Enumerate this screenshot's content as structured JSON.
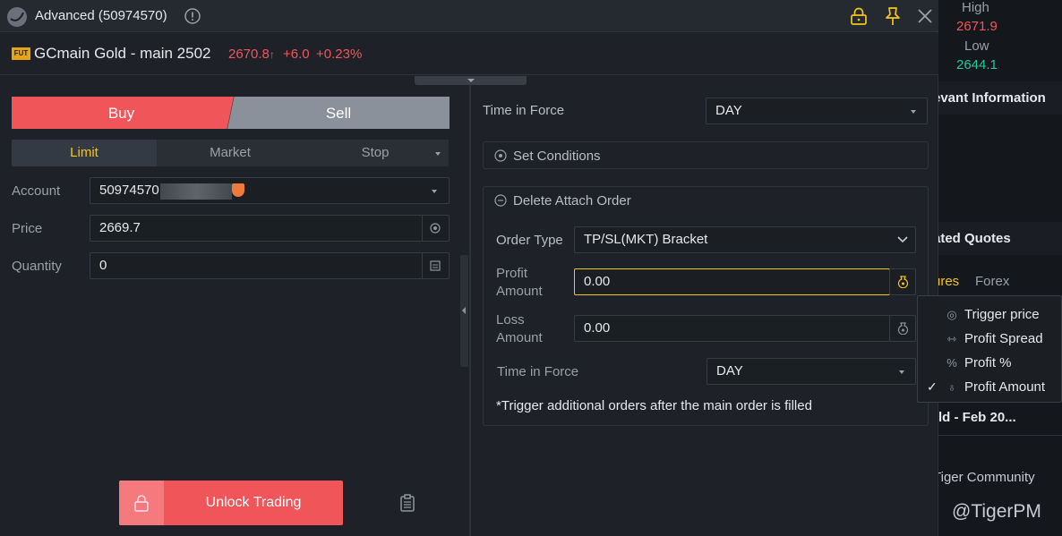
{
  "window": {
    "title": "Advanced (50974570)",
    "info_icon": "info-circle-icon",
    "lock_icon": "lock-icon",
    "pin_icon": "pin-icon",
    "close_icon": "close-icon"
  },
  "symbol": {
    "badge": "FUT",
    "name": "GCmain Gold - main 2502",
    "last": "2670.8",
    "arrow": "↑",
    "change": "+6.0",
    "change_pct": "+0.23%"
  },
  "background": {
    "high_label": "High",
    "high_value": "2671.9",
    "low_label": "Low",
    "low_value": "2644.1",
    "relevant_info": "evant Information",
    "related_quotes": "ated Quotes",
    "tab_futures": "ures",
    "tab_forex": "Forex",
    "list_item": "ld - Feb 20...",
    "community_label": "Tiger Community",
    "handle": "@TigerPM"
  },
  "order": {
    "buy_label": "Buy",
    "sell_label": "Sell",
    "types": {
      "limit": "Limit",
      "market": "Market",
      "stop": "Stop"
    },
    "account_label": "Account",
    "account_value": "50974570",
    "price_label": "Price",
    "price_value": "2669.7",
    "quantity_label": "Quantity",
    "quantity_value": "0",
    "unlock_label": "Unlock Trading"
  },
  "right_panel": {
    "tif_label": "Time in Force",
    "tif_value": "DAY",
    "set_conditions": "Set Conditions",
    "delete_attach": "Delete Attach Order",
    "order_type_label": "Order Type",
    "order_type_value": "TP/SL(MKT) Bracket",
    "profit_label_1": "Profit",
    "profit_label_2": "Amount",
    "profit_value": "0.00",
    "loss_label_1": "Loss",
    "loss_label_2": "Amount",
    "loss_value": "0.00",
    "tif2_label": "Time in Force",
    "tif2_value": "DAY",
    "note": "*Trigger additional orders after the main order is filled"
  },
  "menu": {
    "items": [
      {
        "label": "Trigger price",
        "icon": "trigger-price-icon",
        "checked": false
      },
      {
        "label": "Profit Spread",
        "icon": "profit-spread-icon",
        "checked": false
      },
      {
        "label": "Profit %",
        "icon": "percent-icon",
        "checked": false
      },
      {
        "label": "Profit Amount",
        "icon": "profit-amount-icon",
        "checked": true
      }
    ],
    "check": "✓"
  },
  "colors": {
    "buy": "#f0555a",
    "sell": "#8b919b",
    "accent": "#f5c518",
    "up": "#f0555a",
    "down": "#20c997"
  }
}
